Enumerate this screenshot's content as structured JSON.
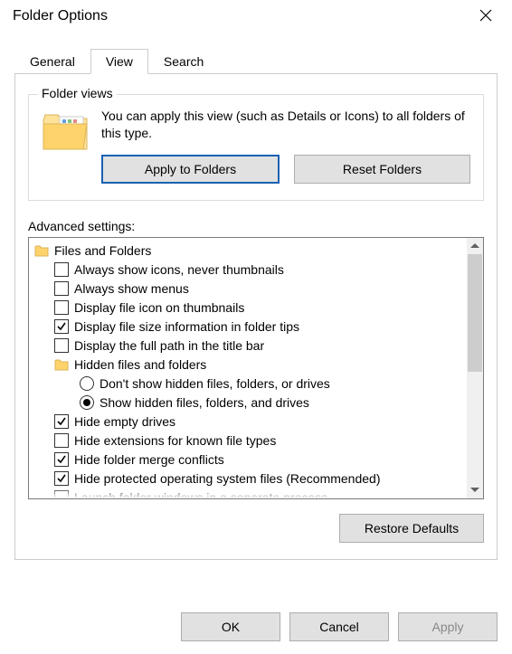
{
  "window": {
    "title": "Folder Options"
  },
  "tabs": {
    "general": "General",
    "view": "View",
    "search": "Search",
    "active": "view"
  },
  "folder_views": {
    "legend": "Folder views",
    "text": "You can apply this view (such as Details or Icons) to all folders of this type.",
    "apply": "Apply to Folders",
    "reset": "Reset Folders"
  },
  "advanced": {
    "label": "Advanced settings:",
    "root": "Files and Folders",
    "items": [
      {
        "label": "Always show icons, never thumbnails",
        "checked": false
      },
      {
        "label": "Always show menus",
        "checked": false
      },
      {
        "label": "Display file icon on thumbnails",
        "checked": false
      },
      {
        "label": "Display file size information in folder tips",
        "checked": true
      },
      {
        "label": "Display the full path in the title bar",
        "checked": false
      }
    ],
    "hidden_group": {
      "label": "Hidden files and folders",
      "opts": [
        {
          "label": "Don't show hidden files, folders, or drives",
          "selected": false
        },
        {
          "label": "Show hidden files, folders, and drives",
          "selected": true
        }
      ]
    },
    "items2": [
      {
        "label": "Hide empty drives",
        "checked": true
      },
      {
        "label": "Hide extensions for known file types",
        "checked": false
      },
      {
        "label": "Hide folder merge conflicts",
        "checked": true
      },
      {
        "label": "Hide protected operating system files (Recommended)",
        "checked": true
      }
    ],
    "cutoff": "Launch folder windows in a separate process"
  },
  "buttons": {
    "restore": "Restore Defaults",
    "ok": "OK",
    "cancel": "Cancel",
    "apply": "Apply"
  }
}
